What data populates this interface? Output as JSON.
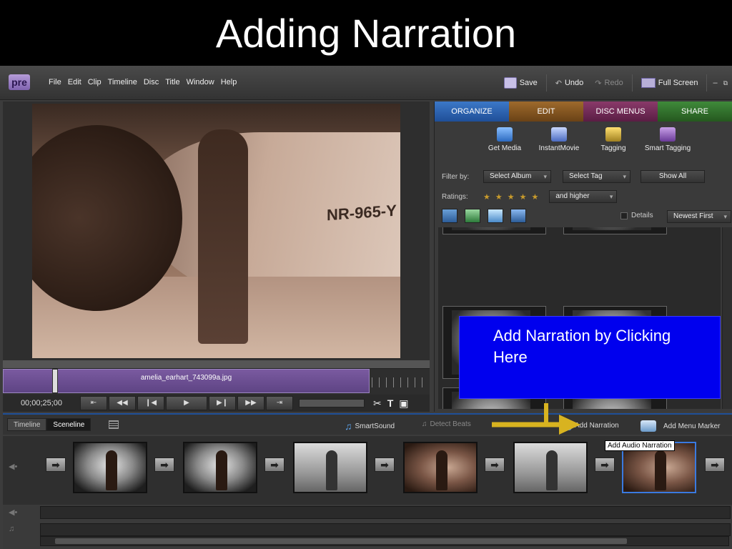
{
  "slide": {
    "title": "Adding Narration"
  },
  "app": {
    "logo": "pre",
    "menus": [
      "File",
      "Edit",
      "Clip",
      "Timeline",
      "Disc",
      "Title",
      "Window",
      "Help"
    ],
    "toolbar": {
      "save": "Save",
      "undo": "Undo",
      "redo": "Redo",
      "fullscreen": "Full Screen"
    }
  },
  "monitor": {
    "registration": "NR-965-Y",
    "clip_name": "amelia_earhart_743099a.jpg",
    "timecode": "00;00;25;00"
  },
  "panel": {
    "tabs": [
      "ORGANIZE",
      "EDIT",
      "DISC MENUS",
      "SHARE"
    ],
    "tools": [
      "Get Media",
      "InstantMovie",
      "Tagging",
      "Smart Tagging"
    ],
    "filter": {
      "label": "Filter by:",
      "album": "Select Album",
      "tag": "Select Tag",
      "show_all": "Show All"
    },
    "ratings": {
      "label": "Ratings:",
      "qualifier": "and higher",
      "stars": 5
    },
    "details": "Details",
    "sort": "Newest First"
  },
  "callout": {
    "text": "Add Narration by Clicking Here"
  },
  "bottom": {
    "view_tabs": [
      "Timeline",
      "Sceneline"
    ],
    "smartsound": "SmartSound",
    "detect_beats": "Detect Beats",
    "add_narration": "Add Narration",
    "add_menu_marker": "Add Menu Marker",
    "tooltip": "Add Audio Narration"
  },
  "colors": {
    "organize": "#1f4f98",
    "edit": "#6a4216",
    "disc": "#5a1e44",
    "share": "#25581f",
    "callout": "#0000ee",
    "arrow": "#d8b320"
  }
}
